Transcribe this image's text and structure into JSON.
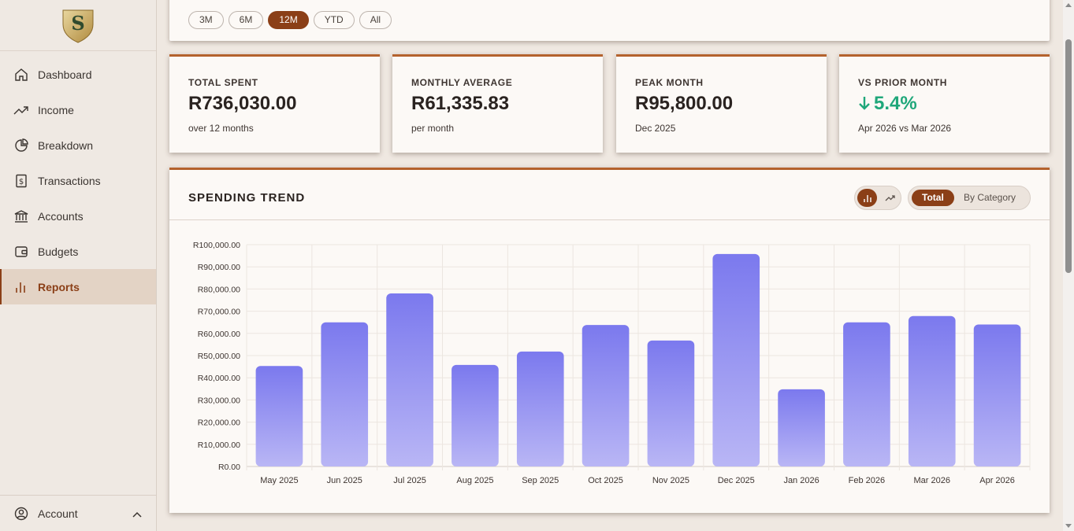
{
  "brand": {
    "logo_letter": "S"
  },
  "sidebar": {
    "items": [
      {
        "label": "Dashboard",
        "icon": "home-icon"
      },
      {
        "label": "Income",
        "icon": "trending-up-icon"
      },
      {
        "label": "Breakdown",
        "icon": "pie-chart-icon"
      },
      {
        "label": "Transactions",
        "icon": "receipt-icon"
      },
      {
        "label": "Accounts",
        "icon": "bank-icon"
      },
      {
        "label": "Budgets",
        "icon": "wallet-icon"
      },
      {
        "label": "Reports",
        "icon": "bar-chart-icon",
        "active": true
      }
    ],
    "account_label": "Account"
  },
  "range": {
    "options": [
      "3M",
      "6M",
      "12M",
      "YTD",
      "All"
    ],
    "selected": "12M"
  },
  "stats": [
    {
      "label": "TOTAL SPENT",
      "value": "R736,030.00",
      "sub": "over 12 months"
    },
    {
      "label": "MONTHLY AVERAGE",
      "value": "R61,335.83",
      "sub": "per month"
    },
    {
      "label": "PEAK MONTH",
      "value": "R95,800.00",
      "sub": "Dec 2025"
    },
    {
      "label": "VS PRIOR MONTH",
      "value": "5.4%",
      "sub": "Apr 2026 vs Mar 2026",
      "direction": "down"
    }
  ],
  "chart_panel": {
    "title": "SPENDING TREND",
    "view_total": "Total",
    "view_category": "By Category"
  },
  "colors": {
    "accent": "#8b3f17",
    "bar_top": "#7b79ee",
    "bar_bottom": "#b9b6f5",
    "positive": "#1fa77a"
  },
  "chart_data": {
    "type": "bar",
    "categories": [
      "May 2025",
      "Jun 2025",
      "Jul 2025",
      "Aug 2025",
      "Sep 2025",
      "Oct 2025",
      "Nov 2025",
      "Dec 2025",
      "Jan 2026",
      "Feb 2026",
      "Mar 2026",
      "Apr 2026"
    ],
    "values": [
      45300,
      65000,
      78000,
      45800,
      51800,
      63800,
      56800,
      95800,
      34800,
      65000,
      67800,
      64000
    ],
    "yticks": [
      "R0.00",
      "R10,000.00",
      "R20,000.00",
      "R30,000.00",
      "R40,000.00",
      "R50,000.00",
      "R60,000.00",
      "R70,000.00",
      "R80,000.00",
      "R90,000.00",
      "R100,000.00"
    ],
    "ylim": [
      0,
      100000
    ],
    "grid": true
  }
}
